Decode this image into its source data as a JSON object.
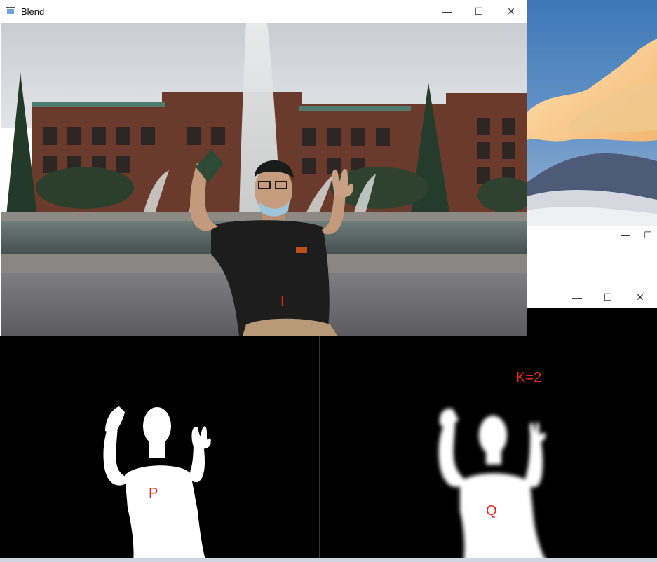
{
  "blend_window": {
    "title": "Blend",
    "label": "I",
    "controls": [
      "minimize",
      "maximize",
      "close"
    ]
  },
  "mask_p_window": {
    "label": "P"
  },
  "mask_q_window": {
    "label": "Q",
    "k_label": "K=2"
  },
  "colors": {
    "label_red": "#e8261d",
    "titlebar_bg": "#ffffff",
    "mask_bg": "#000000",
    "mask_fg": "#ffffff"
  },
  "icons": [
    "app-icon",
    "minimize-icon",
    "maximize-icon",
    "close-icon"
  ]
}
